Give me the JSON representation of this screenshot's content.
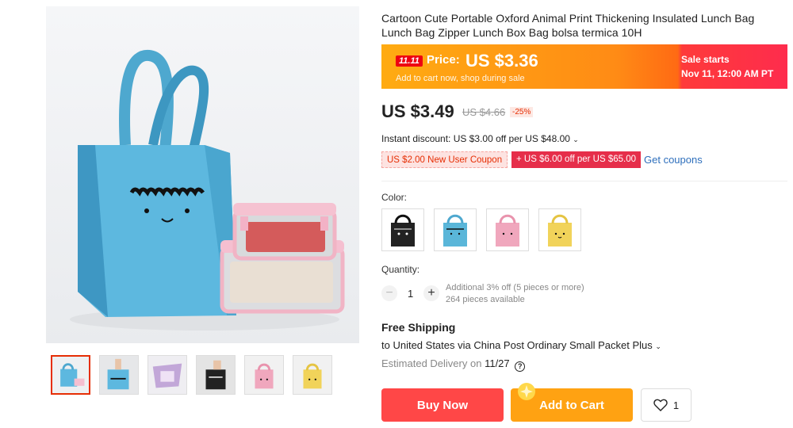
{
  "gallery": {
    "thumbnails": [
      "thumb-blue-bag",
      "thumb-hand-blue-bag",
      "thumb-open-purple-bag",
      "thumb-black-bag",
      "thumb-pink-bag",
      "thumb-yellow-bag"
    ],
    "active_index": 0
  },
  "product": {
    "title": "Cartoon Cute Portable Oxford Animal Print Thickening Insulated Lunch Bag Lunch Bag Zipper Lunch Box Bag bolsa termica 10H"
  },
  "promo": {
    "badge": "11.11",
    "price_label": "Price:",
    "price_value": "US $3.36",
    "subtitle": "Add to cart now, shop during sale",
    "sale_line1": "Sale starts",
    "sale_line2": "Nov 11, 12:00 AM PT",
    "colors": {
      "start": "#ffab12",
      "mid": "#ff6a14",
      "end": "#fe2c4d"
    }
  },
  "pricing": {
    "current": "US $3.49",
    "original": "US $4.66",
    "discount": "-25%",
    "instant_discount": "Instant discount: US $3.00 off per US $48.00",
    "coupon1": "US $2.00 New User Coupon",
    "coupon2": "+ US $6.00 off per US $65.00",
    "get_coupons": "Get coupons"
  },
  "color": {
    "label": "Color:",
    "options": [
      {
        "name": "black",
        "hex": "#222222"
      },
      {
        "name": "blue",
        "hex": "#5ab6d9"
      },
      {
        "name": "pink",
        "hex": "#f0a7bd"
      },
      {
        "name": "yellow",
        "hex": "#f1d35a"
      }
    ]
  },
  "quantity": {
    "label": "Quantity:",
    "value": "1",
    "minus": "−",
    "plus": "+",
    "note1": "Additional 3% off (5 pieces or more)",
    "note2": "264 pieces available"
  },
  "shipping": {
    "title": "Free Shipping",
    "detail": "to United States via China Post Ordinary Small Packet Plus",
    "est_label": "Estimated Delivery on",
    "est_date": "11/27",
    "help": "?"
  },
  "actions": {
    "buy_now": "Buy Now",
    "add_to_cart": "Add to Cart",
    "wishlist_count": "1"
  },
  "accent": {
    "red": "#ff4747",
    "orange": "#ffa212",
    "link": "#2e6fbc"
  }
}
